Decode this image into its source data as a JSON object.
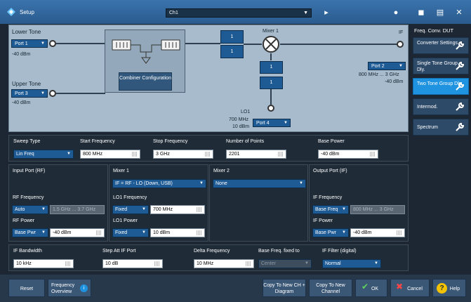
{
  "window": {
    "title": "Setup",
    "channel": "Ch1"
  },
  "diagram": {
    "lower_tone": "Lower Tone",
    "lower_port": "Port 1",
    "lower_power": "-40 dBm",
    "upper_tone": "Upper Tone",
    "upper_port": "Port 3",
    "upper_power": "-40 dBm",
    "combiner_label": "Combiner Configuration",
    "box_a": "1",
    "box_b": "1",
    "box_c": "1",
    "box_d": "1",
    "mixer1": "Mixer 1",
    "if_label": "IF",
    "out_port": "Port 2",
    "out_range": "800 MHz ... 3 GHz",
    "out_power": "-40 dBm",
    "lo1_label": "LO1",
    "lo1_freq": "700 MHz",
    "lo1_power": "10 dBm",
    "lo1_port": "Port 4"
  },
  "sweep": {
    "type_label": "Sweep Type",
    "type_value": "Lin Freq",
    "start_label": "Start Frequency",
    "start_value": "800 MHz",
    "stop_label": "Stop Frequency",
    "stop_value": "3 GHz",
    "points_label": "Number of Points",
    "points_value": "2201",
    "power_label": "Base Power",
    "power_value": "-40 dBm"
  },
  "input_port": {
    "title": "Input Port (RF)",
    "rf_freq_label": "RF Frequency",
    "rf_freq_mode": "Auto",
    "rf_freq_value": "1.5 GHz ... 3.7 GHz",
    "rf_power_label": "RF Power",
    "rf_power_mode": "Base Pwr",
    "rf_power_value": "-40 dBm"
  },
  "mixer1": {
    "title": "Mixer 1",
    "mode": "IF = RF - LO (Down, USB)",
    "lo_freq_label": "LO1 Frequency",
    "lo_freq_mode": "Fixed",
    "lo_freq_value": "700 MHz",
    "lo_power_label": "LO1 Power",
    "lo_power_mode": "Fixed",
    "lo_power_value": "10 dBm"
  },
  "mixer2": {
    "title": "Mixer 2",
    "mode": "None"
  },
  "output_port": {
    "title": "Output Port (IF)",
    "if_freq_label": "IF Frequency",
    "if_freq_mode": "Base Freq",
    "if_freq_value": "800 MHz ... 3 GHz",
    "if_power_label": "IF Power",
    "if_power_mode": "Base Pwr",
    "if_power_value": "-40 dBm"
  },
  "if_row": {
    "bw_label": "IF Bandwidth",
    "bw_value": "10 kHz",
    "step_label": "Step Att IF Port",
    "step_value": "10 dB",
    "delta_label": "Delta Frequency",
    "delta_value": "10 MHz",
    "base_fixed_label": "Base Freq. fixed to",
    "base_fixed_value": "Center",
    "filter_label": "IF Filter (digital)",
    "filter_value": "Normal"
  },
  "buttons": {
    "reset": "Reset",
    "freq_overview": "Frequency Overview",
    "copy_ch": "Copy To New CH + Diagram",
    "copy_channel": "Copy To New Channel",
    "ok": "OK",
    "cancel": "Cancel",
    "help": "Help"
  },
  "sidebar": {
    "title": "Freq. Conv. DUT",
    "items": [
      "Converter Settings",
      "Single Tone Group Dly.",
      "Two Tone Group Dly.",
      "Intermod.",
      "Spectrum"
    ]
  }
}
